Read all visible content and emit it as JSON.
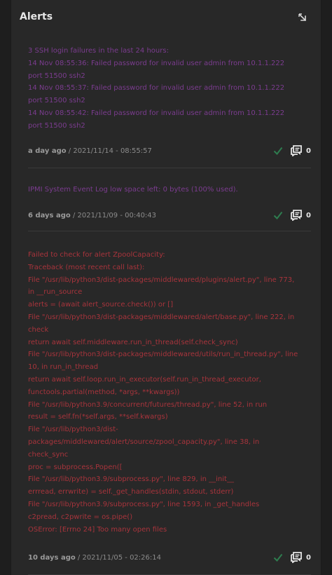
{
  "header": {
    "title": "Alerts",
    "expand_icon": "expand-icon"
  },
  "alerts": [
    {
      "level": "warning",
      "color": "#7b3c8f",
      "message": "3 SSH login failures in the last 24 hours:\n14 Nov 08:55:36: Failed password for invalid user admin from 10.1.1.222 port 51500 ssh2\n14 Nov 08:55:37: Failed password for invalid user admin from 10.1.1.222 port 51500 ssh2\n14 Nov 08:55:42: Failed password for invalid user admin from 10.1.1.222 port 51500 ssh2",
      "ago": "a day ago",
      "datetime": " / 2021/11/14 - 08:55:57",
      "comment_count": "0"
    },
    {
      "level": "warning",
      "color": "#7b3c8f",
      "message": "IPMI System Event Log low space left: 0 bytes (100% used).",
      "ago": "6 days ago",
      "datetime": " / 2021/11/09 - 00:40:43",
      "comment_count": "0"
    },
    {
      "level": "critical",
      "color": "#a8343c",
      "message": "Failed to check for alert ZpoolCapacity:\nTraceback (most recent call last):\nFile \"/usr/lib/python3/dist-packages/middlewared/plugins/alert.py\", line 773, in __run_source\nalerts = (await alert_source.check()) or []\nFile \"/usr/lib/python3/dist-packages/middlewared/alert/base.py\", line 222, in check\nreturn await self.middleware.run_in_thread(self.check_sync)\nFile \"/usr/lib/python3/dist-packages/middlewared/utils/run_in_thread.py\", line 10, in run_in_thread\nreturn await self.loop.run_in_executor(self.run_in_thread_executor, functools.partial(method, *args, **kwargs))\nFile \"/usr/lib/python3.9/concurrent/futures/thread.py\", line 52, in run\nresult = self.fn(*self.args, **self.kwargs)\nFile \"/usr/lib/python3/dist-packages/middlewared/alert/source/zpool_capacity.py\", line 38, in check_sync\nproc = subprocess.Popen([\nFile \"/usr/lib/python3.9/subprocess.py\", line 829, in __init__\nerrread, errwrite) = self._get_handles(stdin, stdout, stderr)\nFile \"/usr/lib/python3.9/subprocess.py\", line 1593, in _get_handles\nc2pread, c2pwrite = os.pipe()\nOSError: [Errno 24] Too many open files",
      "ago": "10 days ago",
      "datetime": " / 2021/11/05 - 02:26:14",
      "comment_count": "0"
    }
  ],
  "icons": {
    "dismiss": "check-icon",
    "comments": "comment-icon"
  },
  "colors": {
    "check": "#2e7d4f",
    "comment": "#e6e6e6"
  }
}
